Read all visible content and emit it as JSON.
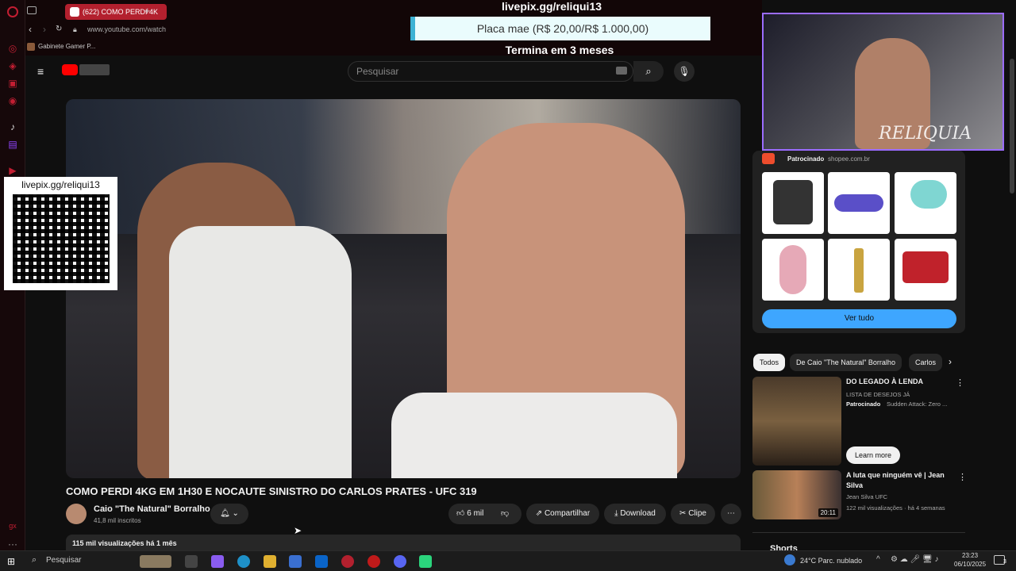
{
  "browser": {
    "tab_title": "(622) COMO PERDI 4K",
    "url": "www.youtube.com/watch",
    "bookmark": "Gabinete Gamer P..."
  },
  "overlay": {
    "pix_url": "livepix.gg/reliqui13",
    "goal_text": "Placa mae (R$ 20,00/R$ 1.000,00)",
    "goal_ends": "Termina em 3 meses",
    "qr_url": "livepix.gg/reliqui13",
    "cam_watermark": "RELIQUIA"
  },
  "youtube": {
    "search_placeholder": "Pesquisar",
    "video_title": "COMO PERDI 4KG EM 1H30 E NOCAUTE SINISTRO DO CARLOS PRATES - UFC 319",
    "channel_name": "Caio \"The Natural\" Borralho",
    "subscribers": "41,8 mil inscritos",
    "likes": "6 mil",
    "share_label": "Compartilhar",
    "download_label": "Download",
    "clip_label": "Clipe",
    "views_line": "115 mil visualizações  há 1 mês"
  },
  "sidebar": {
    "ad_sponsored": "Patrocinado",
    "ad_domain": "shopee.com.br",
    "ver_tudo": "Ver tudo",
    "chips": [
      "Todos",
      "De Caio \"The Natural\" Borralho",
      "Carlos"
    ],
    "recs": [
      {
        "title": "DO LEGADO À LENDA",
        "sub1": "LISTA DE DESEJOS JÁ",
        "sponsored": "Patrocinado",
        "sub2": "Sudden Attack: Zero ...",
        "cta": "Learn more"
      },
      {
        "title": "A luta que ninguém vê | Jean Silva",
        "channel": "Jean Silva UFC",
        "meta": "122 mil visualizações · há 4 semanas",
        "duration": "20:11"
      }
    ],
    "shorts_label": "Shorts"
  },
  "taskbar": {
    "search": "Pesquisar",
    "weather": "24°C  Parc. nublado",
    "time": "23:23",
    "date": "06/10/2025",
    "notif_count": "3"
  }
}
